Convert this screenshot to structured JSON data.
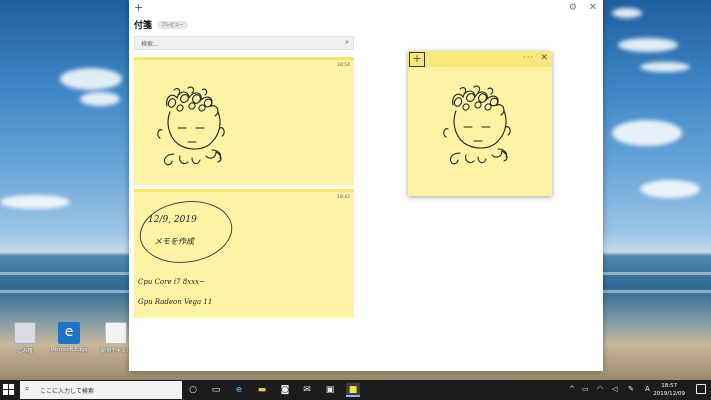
{
  "desktop": {
    "icons": [
      {
        "label": "ごみ箱",
        "icon": "recycle-bin-icon",
        "color": "#d7dde3"
      },
      {
        "label": "Microsoft Edge",
        "icon": "edge-icon",
        "color": "#1f73c7"
      },
      {
        "label": "新規テキスト",
        "icon": "document-icon",
        "color": "#f3f3f3"
      }
    ]
  },
  "sticky_list": {
    "title": "付箋",
    "badge": "プレビュー",
    "new_glyph": "+",
    "settings_glyph": "⚙",
    "close_glyph": "✕",
    "search_placeholder": "検索...",
    "search_glyph": "⌕",
    "notes": [
      {
        "timestamp": "18:54"
      },
      {
        "timestamp": "18:42",
        "handwriting": [
          "12/9, 2019",
          "メモを作成",
          "Cpu  Core i7 8xxx~",
          "Gpu  Radeon Vega 11"
        ]
      }
    ]
  },
  "floating_note": {
    "add_glyph": "+",
    "menu_glyph": "···",
    "close_glyph": "✕"
  },
  "taskbar": {
    "search_placeholder": "ここに入力して検索",
    "search_glyph": "⌕",
    "apps": [
      {
        "name": "task-view-icon",
        "glyph": "○"
      },
      {
        "name": "timeline-icon",
        "glyph": "▭"
      },
      {
        "name": "edge-icon",
        "glyph": "e"
      },
      {
        "name": "file-explorer-icon",
        "glyph": "▬"
      },
      {
        "name": "store-icon",
        "glyph": "◙"
      },
      {
        "name": "mail-icon",
        "glyph": "✉"
      },
      {
        "name": "camera-icon",
        "glyph": "▣"
      },
      {
        "name": "sticky-notes-icon",
        "glyph": "■"
      }
    ],
    "tray": {
      "chevron": "^",
      "ime": "A",
      "time": "18:57",
      "date": "2019/12/09"
    }
  },
  "colors": {
    "note_yellow": "#fdf3a4",
    "note_bar": "#f8e77a",
    "taskbar": "#1c1c1c"
  }
}
